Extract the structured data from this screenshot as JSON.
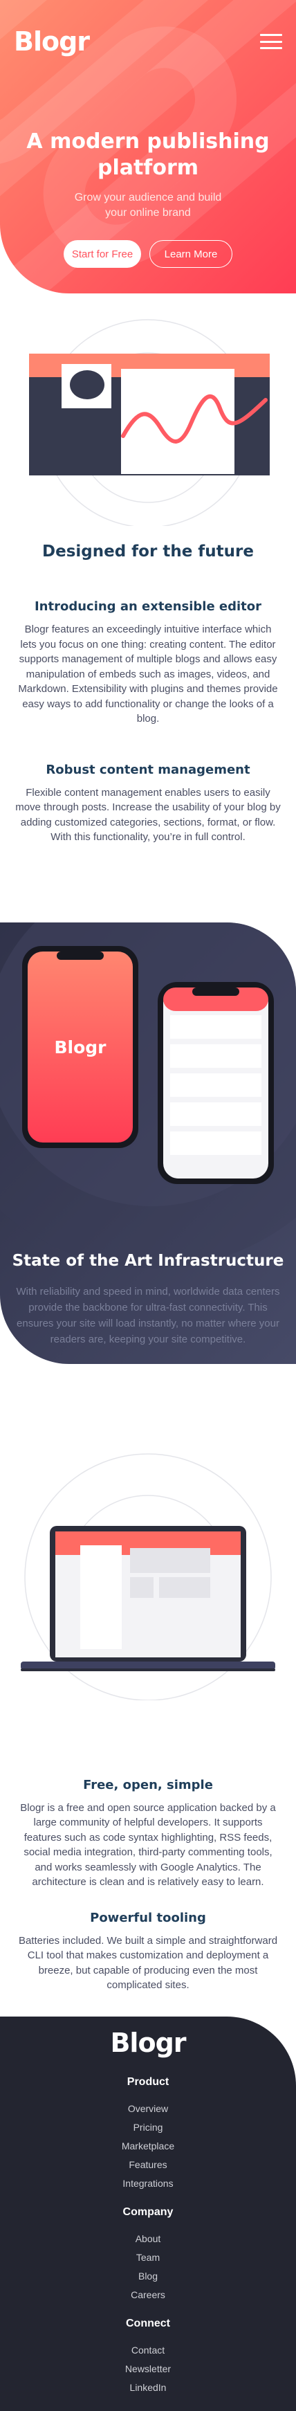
{
  "header": {
    "logo": "Blogr",
    "menu_icon": "hamburger-menu-icon",
    "title": "A modern publishing platform",
    "subtitle": "Grow your audience and build your online brand",
    "primary_button": "Start for Free",
    "secondary_button": "Learn More"
  },
  "future": {
    "title": "Designed for the future",
    "features": [
      {
        "heading": "Introducing an extensible editor",
        "text": "Blogr features an exceedingly intuitive interface which lets you focus on one thing: creating content. The editor supports management of multiple blogs and allows easy manipulation of embeds such as images, videos, and Markdown. Extensibility with plugins and themes provide easy ways to add functionality or change the looks of a blog."
      },
      {
        "heading": "Robust content management",
        "text": "Flexible content management enables users to easily move through posts. Increase the usability of your blog by adding customized categories, sections, format, or flow. With this functionality, you’re in full control."
      }
    ]
  },
  "infrastructure": {
    "phone_logo": "Blogr",
    "title": "State of the Art Infrastructure",
    "text": "With reliability and speed in mind, worldwide data centers provide the backbone for ultra-fast connectivity. This ensures your site will load instantly, no matter where your readers are, keeping your site competitive."
  },
  "simple": {
    "features": [
      {
        "heading": "Free, open, simple",
        "text": "Blogr is a free and open source application backed by a large community of helpful developers. It supports features such as code syntax highlighting, RSS feeds, social media integration, third-party commenting tools, and works seamlessly with Google Analytics. The architecture is clean and is relatively easy to learn."
      },
      {
        "heading": "Powerful tooling",
        "text": "Batteries included. We built a simple and straightforward CLI tool that makes customization and deployment a breeze, but capable of producing even the most complicated sites."
      }
    ]
  },
  "footer": {
    "logo": "Blogr",
    "columns": [
      {
        "heading": "Product",
        "links": [
          "Overview",
          "Pricing",
          "Marketplace",
          "Features",
          "Integrations"
        ]
      },
      {
        "heading": "Company",
        "links": [
          "About",
          "Team",
          "Blog",
          "Careers"
        ]
      },
      {
        "heading": "Connect",
        "links": [
          "Contact",
          "Newsletter",
          "LinkedIn"
        ]
      }
    ]
  },
  "colors": {
    "hero_gradient_start": "#ff8f70",
    "hero_gradient_end": "#ff3d54",
    "infra_gradient_start": "#2c2e44",
    "infra_gradient_end": "#464a67",
    "footer_bg": "#232530",
    "heading_blue": "#1f3e5a"
  }
}
